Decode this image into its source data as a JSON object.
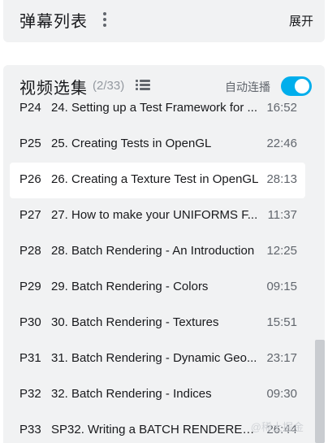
{
  "danmaku": {
    "title": "弹幕列表",
    "expand_label": "展开"
  },
  "playlist": {
    "title": "视频选集",
    "count": "(2/33)",
    "autoplay_label": "自动连播",
    "autoplay_on": true,
    "accent": "#00aeec",
    "episodes": [
      {
        "num": "P24",
        "name": "24. Setting up a Test Framework for ...",
        "duration": "16:52"
      },
      {
        "num": "P25",
        "name": "25. Creating Tests in OpenGL",
        "duration": "22:46"
      },
      {
        "num": "P26",
        "name": "26. Creating a Texture Test in OpenGL",
        "duration": "28:13",
        "active": true
      },
      {
        "num": "P27",
        "name": "27. How to make your UNIFORMS F...",
        "duration": "11:37"
      },
      {
        "num": "P28",
        "name": "28. Batch Rendering - An Introduction",
        "duration": "12:25"
      },
      {
        "num": "P29",
        "name": "29. Batch Rendering - Colors",
        "duration": "09:15"
      },
      {
        "num": "P30",
        "name": "30. Batch Rendering - Textures",
        "duration": "15:51"
      },
      {
        "num": "P31",
        "name": "31. Batch Rendering - Dynamic Geo...",
        "duration": "23:17"
      },
      {
        "num": "P32",
        "name": "32. Batch Rendering - Indices",
        "duration": "09:30"
      },
      {
        "num": "P33",
        "name": "SP32. Writing a BATCH RENDERER...",
        "duration": "26:44"
      }
    ]
  },
  "watermark": "@稀土掘金"
}
